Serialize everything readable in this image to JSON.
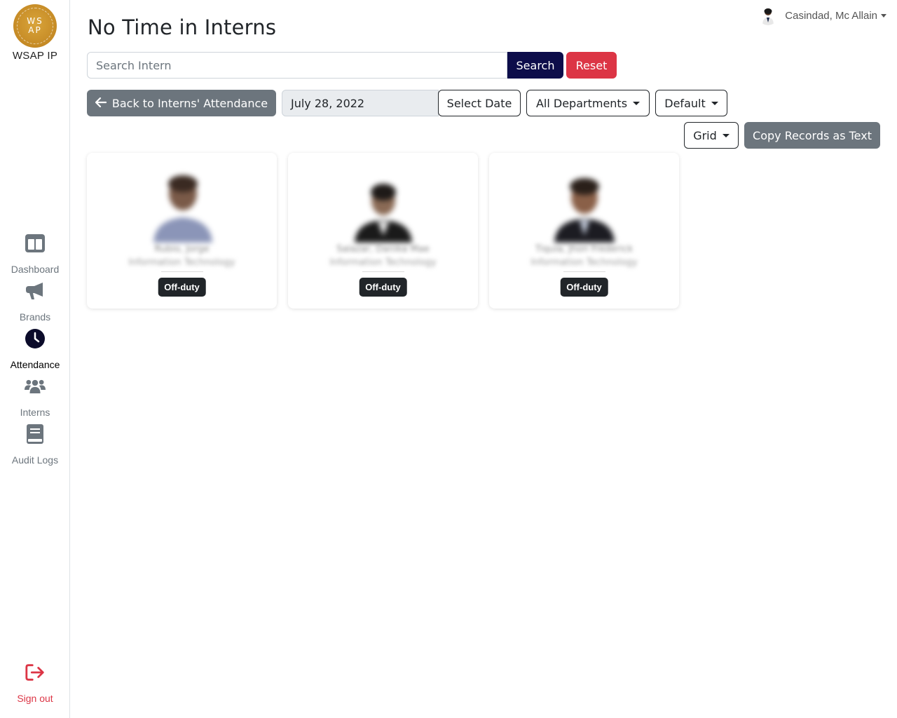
{
  "app": {
    "logo_inner_line1": "WS",
    "logo_inner_line2": "AP",
    "name": "WSAP IP"
  },
  "sidebar": {
    "items": [
      {
        "label": "Dashboard",
        "icon": "columns-icon"
      },
      {
        "label": "Brands",
        "icon": "megaphone-icon"
      },
      {
        "label": "Attendance",
        "icon": "clock-icon",
        "active": true
      },
      {
        "label": "Interns",
        "icon": "users-icon"
      },
      {
        "label": "Audit Logs",
        "icon": "book-icon"
      }
    ],
    "signout": {
      "label": "Sign out",
      "icon": "sign-out-icon"
    }
  },
  "header": {
    "user_name": "Casindad, Mc Allain"
  },
  "page": {
    "title": "No Time in Interns"
  },
  "search": {
    "placeholder": "Search Intern",
    "value": "",
    "search_label": "Search",
    "reset_label": "Reset"
  },
  "filters": {
    "back_label": "Back to Interns' Attendance",
    "date_value": "July 28, 2022",
    "select_date_label": "Select Date",
    "department_label": "All Departments",
    "sort_label": "Default"
  },
  "view": {
    "mode_label": "Grid",
    "copy_label": "Copy Records as Text"
  },
  "interns": [
    {
      "name": "Rubio, Jorge",
      "department": "Information Technology",
      "status": "Off-duty"
    },
    {
      "name": "Salazar, Danika Mae",
      "department": "Information Technology",
      "status": "Off-duty"
    },
    {
      "name": "Tiquia, Jhon Frederick",
      "department": "Information Technology",
      "status": "Off-duty"
    }
  ],
  "colors": {
    "primary": "#0d0d4a",
    "danger": "#dc3545",
    "secondary": "#6c757d",
    "logo_gold": "#c58a25"
  }
}
